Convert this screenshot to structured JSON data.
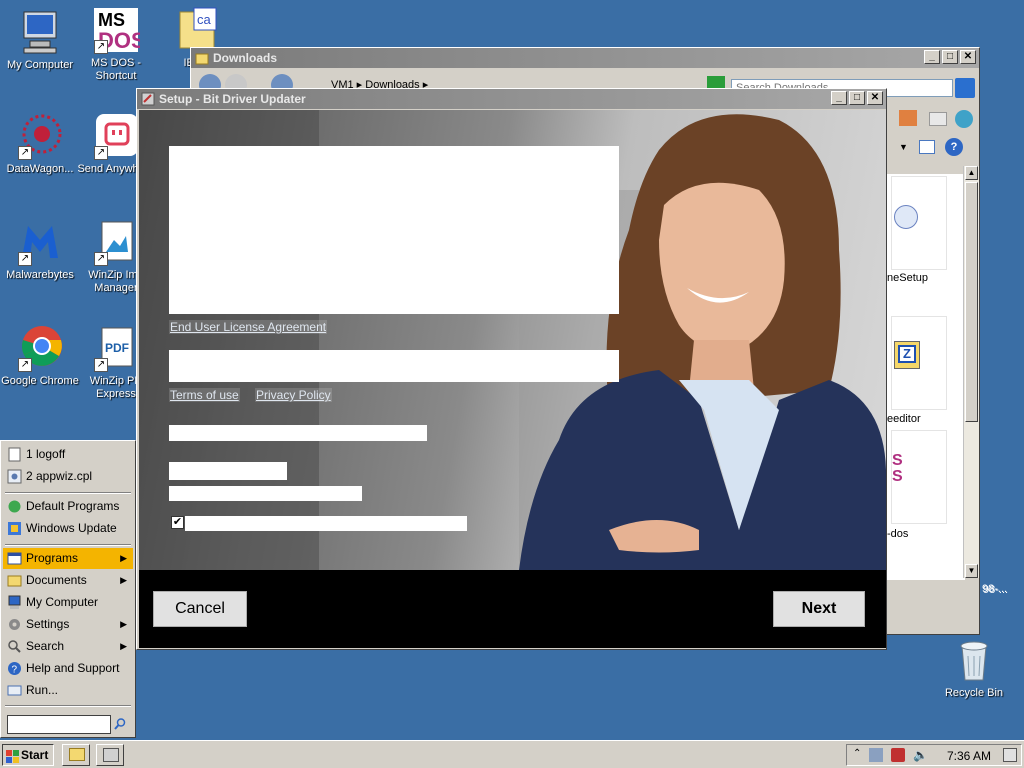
{
  "desktop": {
    "icons": [
      {
        "label": "My Computer"
      },
      {
        "label": "MS DOS - Shortcut"
      },
      {
        "label": "IEXP"
      },
      {
        "label": "DataWagon..."
      },
      {
        "label": "Send Anywhere"
      },
      {
        "label": "Malwarebytes"
      },
      {
        "label": "WinZip Ima Manager"
      },
      {
        "label": "Google Chrome"
      },
      {
        "label": "WinZip PD Express"
      },
      {
        "label": "Recycle Bin"
      }
    ]
  },
  "downloads_window": {
    "title": "Downloads",
    "address": "VM1 ▸ Downloads ▸",
    "search_placeholder": "Search Downloads",
    "files": [
      {
        "label": "neSetup"
      },
      {
        "label": "eeditor"
      },
      {
        "label": "-dos"
      }
    ],
    "status_fragment": "98-..."
  },
  "setup_dialog": {
    "title": "Setup - Bit Driver Updater",
    "eula_link": "End User License Agreement",
    "terms_link": "Terms of use",
    "privacy_link": "Privacy Policy",
    "checkbox_checked": true,
    "cancel_label": "Cancel",
    "next_label": "Next"
  },
  "start_menu": {
    "recent": [
      {
        "label": "1 logoff"
      },
      {
        "label": "2 appwiz.cpl"
      }
    ],
    "pinned": [
      {
        "label": "Default Programs"
      },
      {
        "label": "Windows Update"
      }
    ],
    "main": [
      {
        "label": "Programs",
        "submenu": true
      },
      {
        "label": "Documents",
        "submenu": true
      },
      {
        "label": "My Computer",
        "submenu": false
      },
      {
        "label": "Settings",
        "submenu": true
      },
      {
        "label": "Search",
        "submenu": true
      },
      {
        "label": "Help and Support",
        "submenu": false
      },
      {
        "label": "Run...",
        "submenu": false
      }
    ],
    "run_value": ""
  },
  "taskbar": {
    "start_label": "Start",
    "clock": "7:36 AM"
  },
  "colors": {
    "desktop": "#3a6ea5",
    "highlight": "#f4b400"
  }
}
